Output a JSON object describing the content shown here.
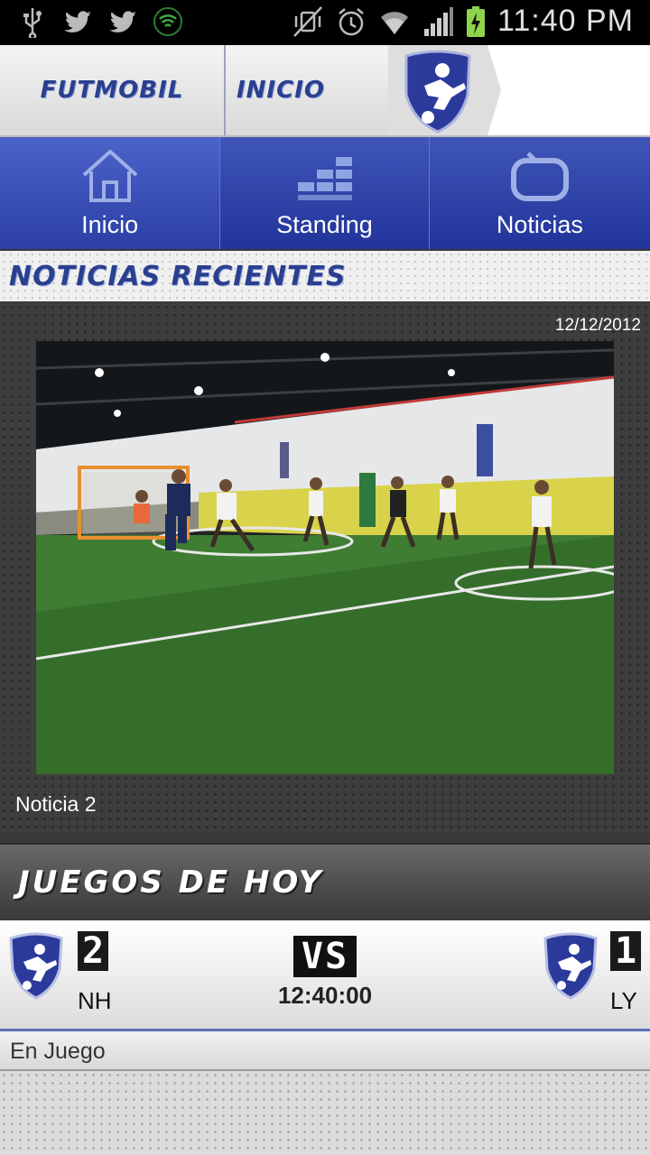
{
  "status_bar": {
    "time": "11:40 PM",
    "left_icons": [
      "usb-icon",
      "twitter-icon",
      "twitter-icon",
      "wifi-signal-icon"
    ],
    "right_icons": [
      "vibrate-off-icon",
      "alarm-icon",
      "wifi-icon",
      "cell-signal-icon",
      "battery-charging-icon"
    ]
  },
  "header": {
    "app_name": "FUTMOBIL",
    "section": "INICIO"
  },
  "tabs": [
    {
      "label": "Inicio",
      "icon": "home-icon"
    },
    {
      "label": "Standing",
      "icon": "bars-icon"
    },
    {
      "label": "Noticias",
      "icon": "tv-icon"
    }
  ],
  "recent": {
    "title": "NOTICIAS RECIENTES",
    "date": "12/12/2012",
    "caption": "Noticia 2"
  },
  "games": {
    "title": "JUEGOS DE HOY",
    "home_score": "2",
    "home_team": "NH",
    "vs": "VS",
    "time": "12:40:00",
    "away_score": "1",
    "away_team": "LY",
    "status": "En Juego"
  },
  "colors": {
    "brand_blue": "#2b3f8f",
    "tab_blue": "#2b3fa5"
  }
}
